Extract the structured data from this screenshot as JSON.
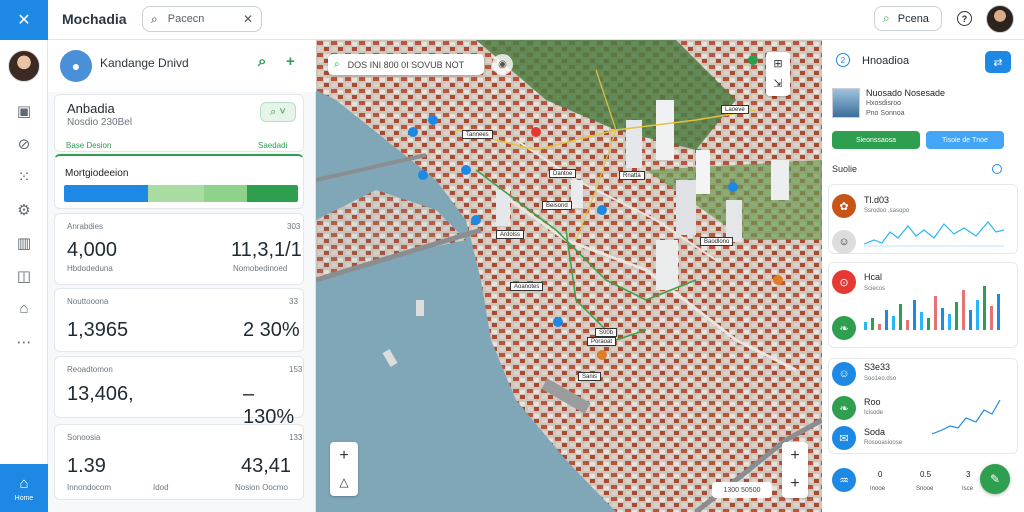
{
  "colors": {
    "accent_blue": "#1e88e5",
    "accent_green": "#2e9e4f",
    "alert_red": "#e53935"
  },
  "rail": {
    "top_icon": "close-icon",
    "items": [
      "image-icon",
      "link-off-icon",
      "grid-icon",
      "settings-icon",
      "building-icon",
      "layout-icon",
      "car-icon",
      "more-icon"
    ],
    "bottom_label": "Home"
  },
  "topbar": {
    "title": "Mochadia",
    "search": {
      "placeholder": "Pacecn"
    },
    "right_button": "Pcena"
  },
  "left_panel": {
    "header_name": "Kandange Dnivd",
    "summary_card": {
      "title": "Anbadia",
      "subtitle": "Nosdio 230Bel",
      "tab_left": "Base Desion",
      "tab_right": "Saedadi"
    },
    "progress_card": {
      "title": "Mortgiodeeion",
      "segments": [
        {
          "fraction": 0.36,
          "color": "#1e88e5"
        },
        {
          "fraction": 0.24,
          "color": "#a8dca0"
        },
        {
          "fraction": 0.18,
          "color": "#8fd38a"
        },
        {
          "fraction": 0.22,
          "color": "#2e9e4f"
        }
      ]
    },
    "stat1": {
      "label": "Anrabdies",
      "tag": "303",
      "value_left": "4,000",
      "sub_left": "Hbdodeduna",
      "value_right": "11,3,1/1",
      "sub_right": "Nomobedinoed"
    },
    "stat2": {
      "label": "Nouttooona",
      "tag": "33",
      "value_left": "1,3965",
      "value_right": "2 30%"
    },
    "stat3": {
      "label": "Reoadtomon",
      "tag": "153",
      "value_left": "13,406,",
      "value_right": "–130%"
    },
    "stat4": {
      "label": "Sonoosia",
      "tag": "133",
      "value_left": "1.39",
      "sub_left": "Innondocom",
      "sub_mid": "Idod",
      "value_right": "43,41",
      "sub_right": "Nosion Oocmo"
    }
  },
  "map": {
    "search_text": "DOS INI 800 0I SOVUB NOT",
    "scale_chip": "1300 50500",
    "labels": [
      "Tannees",
      "Dantoe",
      "Ardolss",
      "Rnatta",
      "Aoanotes",
      "Laoeve",
      "Baodlono",
      "Beisond",
      "Poraoat",
      "Sanis",
      "S00b"
    ]
  },
  "right_panel": {
    "number": "2",
    "title": "Hnoadioa",
    "profile": {
      "line1": "Nuosado Nosesade",
      "line2": "Hxosdisroo",
      "line3": "Pno Sonnoa"
    },
    "btn_green": "Sieonssaosa",
    "btn_blue": "Tisoie de Tnoe",
    "section": "Suolie",
    "list": [
      {
        "t1": "Tl.d03",
        "t2": "Ssrodoo ,sasopo",
        "color": "#c7551a",
        "icon": "food-icon"
      },
      {
        "t1": "Hcal",
        "t2": "Sciecos",
        "color": "#e53935",
        "icon": "pin-icon"
      },
      {
        "t1": "S3e33",
        "t2": "Soo1eo.dso",
        "color": "#1e88e5",
        "icon": "person-icon"
      },
      {
        "t1": "Roo",
        "t2": "Icisode",
        "color": "#2e9e4f",
        "icon": "leaf-icon"
      },
      {
        "t1": "Soda",
        "t2": "Rosooasioose",
        "color": "#1e88e5",
        "icon": "chat-icon"
      }
    ],
    "footer": [
      {
        "v": "0",
        "l": "Inooe"
      },
      {
        "v": "0.5",
        "l": "Snooe"
      },
      {
        "v": "3",
        "l": "Isce"
      }
    ]
  }
}
